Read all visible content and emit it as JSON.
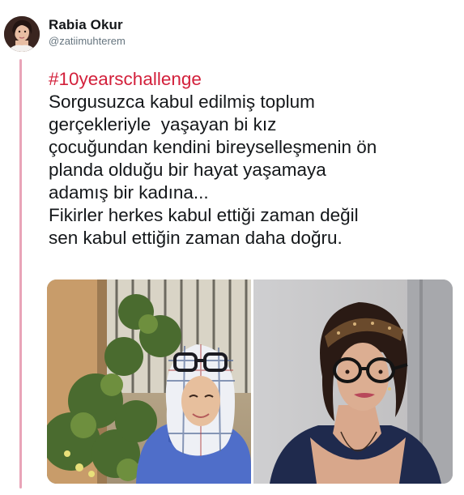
{
  "tweet": {
    "author": {
      "display_name": "Rabia Okur",
      "handle": "@zatiimuhterem"
    },
    "hashtag": "#10yearschallenge",
    "text_lines": [
      "Sorgusuzca kabul edilmiş toplum",
      "gerçekleriyle  yaşayan bi kız",
      "çocuğundan kendini bireyselleşmenin ön",
      "planda olduğu bir hayat yaşamaya",
      "adamış bir kadına...",
      "Fikirler herkes kabul ettiği zaman değil",
      "sen kabul ettiğin zaman daha doğru."
    ],
    "media_count": 2
  },
  "colors": {
    "hashtag": "#d3203b",
    "thread_line": "#e9a4b8",
    "text": "#14171a",
    "handle": "#66757f"
  }
}
